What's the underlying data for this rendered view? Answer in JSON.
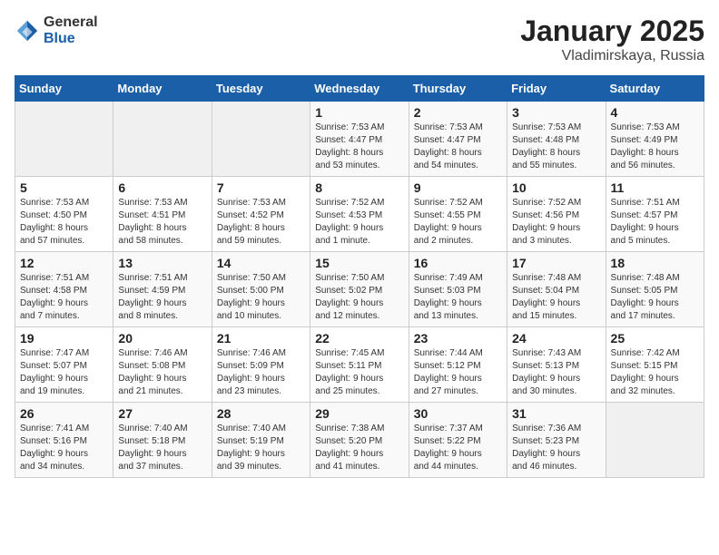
{
  "logo": {
    "general": "General",
    "blue": "Blue"
  },
  "title": "January 2025",
  "subtitle": "Vladimirskaya, Russia",
  "days_of_week": [
    "Sunday",
    "Monday",
    "Tuesday",
    "Wednesday",
    "Thursday",
    "Friday",
    "Saturday"
  ],
  "weeks": [
    [
      {
        "day": "",
        "info": ""
      },
      {
        "day": "",
        "info": ""
      },
      {
        "day": "",
        "info": ""
      },
      {
        "day": "1",
        "info": "Sunrise: 7:53 AM\nSunset: 4:47 PM\nDaylight: 8 hours\nand 53 minutes."
      },
      {
        "day": "2",
        "info": "Sunrise: 7:53 AM\nSunset: 4:47 PM\nDaylight: 8 hours\nand 54 minutes."
      },
      {
        "day": "3",
        "info": "Sunrise: 7:53 AM\nSunset: 4:48 PM\nDaylight: 8 hours\nand 55 minutes."
      },
      {
        "day": "4",
        "info": "Sunrise: 7:53 AM\nSunset: 4:49 PM\nDaylight: 8 hours\nand 56 minutes."
      }
    ],
    [
      {
        "day": "5",
        "info": "Sunrise: 7:53 AM\nSunset: 4:50 PM\nDaylight: 8 hours\nand 57 minutes."
      },
      {
        "day": "6",
        "info": "Sunrise: 7:53 AM\nSunset: 4:51 PM\nDaylight: 8 hours\nand 58 minutes."
      },
      {
        "day": "7",
        "info": "Sunrise: 7:53 AM\nSunset: 4:52 PM\nDaylight: 8 hours\nand 59 minutes."
      },
      {
        "day": "8",
        "info": "Sunrise: 7:52 AM\nSunset: 4:53 PM\nDaylight: 9 hours\nand 1 minute."
      },
      {
        "day": "9",
        "info": "Sunrise: 7:52 AM\nSunset: 4:55 PM\nDaylight: 9 hours\nand 2 minutes."
      },
      {
        "day": "10",
        "info": "Sunrise: 7:52 AM\nSunset: 4:56 PM\nDaylight: 9 hours\nand 3 minutes."
      },
      {
        "day": "11",
        "info": "Sunrise: 7:51 AM\nSunset: 4:57 PM\nDaylight: 9 hours\nand 5 minutes."
      }
    ],
    [
      {
        "day": "12",
        "info": "Sunrise: 7:51 AM\nSunset: 4:58 PM\nDaylight: 9 hours\nand 7 minutes."
      },
      {
        "day": "13",
        "info": "Sunrise: 7:51 AM\nSunset: 4:59 PM\nDaylight: 9 hours\nand 8 minutes."
      },
      {
        "day": "14",
        "info": "Sunrise: 7:50 AM\nSunset: 5:00 PM\nDaylight: 9 hours\nand 10 minutes."
      },
      {
        "day": "15",
        "info": "Sunrise: 7:50 AM\nSunset: 5:02 PM\nDaylight: 9 hours\nand 12 minutes."
      },
      {
        "day": "16",
        "info": "Sunrise: 7:49 AM\nSunset: 5:03 PM\nDaylight: 9 hours\nand 13 minutes."
      },
      {
        "day": "17",
        "info": "Sunrise: 7:48 AM\nSunset: 5:04 PM\nDaylight: 9 hours\nand 15 minutes."
      },
      {
        "day": "18",
        "info": "Sunrise: 7:48 AM\nSunset: 5:05 PM\nDaylight: 9 hours\nand 17 minutes."
      }
    ],
    [
      {
        "day": "19",
        "info": "Sunrise: 7:47 AM\nSunset: 5:07 PM\nDaylight: 9 hours\nand 19 minutes."
      },
      {
        "day": "20",
        "info": "Sunrise: 7:46 AM\nSunset: 5:08 PM\nDaylight: 9 hours\nand 21 minutes."
      },
      {
        "day": "21",
        "info": "Sunrise: 7:46 AM\nSunset: 5:09 PM\nDaylight: 9 hours\nand 23 minutes."
      },
      {
        "day": "22",
        "info": "Sunrise: 7:45 AM\nSunset: 5:11 PM\nDaylight: 9 hours\nand 25 minutes."
      },
      {
        "day": "23",
        "info": "Sunrise: 7:44 AM\nSunset: 5:12 PM\nDaylight: 9 hours\nand 27 minutes."
      },
      {
        "day": "24",
        "info": "Sunrise: 7:43 AM\nSunset: 5:13 PM\nDaylight: 9 hours\nand 30 minutes."
      },
      {
        "day": "25",
        "info": "Sunrise: 7:42 AM\nSunset: 5:15 PM\nDaylight: 9 hours\nand 32 minutes."
      }
    ],
    [
      {
        "day": "26",
        "info": "Sunrise: 7:41 AM\nSunset: 5:16 PM\nDaylight: 9 hours\nand 34 minutes."
      },
      {
        "day": "27",
        "info": "Sunrise: 7:40 AM\nSunset: 5:18 PM\nDaylight: 9 hours\nand 37 minutes."
      },
      {
        "day": "28",
        "info": "Sunrise: 7:40 AM\nSunset: 5:19 PM\nDaylight: 9 hours\nand 39 minutes."
      },
      {
        "day": "29",
        "info": "Sunrise: 7:38 AM\nSunset: 5:20 PM\nDaylight: 9 hours\nand 41 minutes."
      },
      {
        "day": "30",
        "info": "Sunrise: 7:37 AM\nSunset: 5:22 PM\nDaylight: 9 hours\nand 44 minutes."
      },
      {
        "day": "31",
        "info": "Sunrise: 7:36 AM\nSunset: 5:23 PM\nDaylight: 9 hours\nand 46 minutes."
      },
      {
        "day": "",
        "info": ""
      }
    ]
  ]
}
